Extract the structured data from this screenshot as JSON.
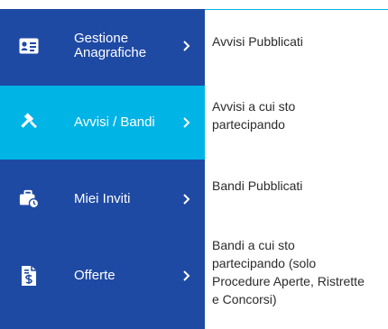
{
  "colors": {
    "sidebar": "#1f4aa4",
    "active": "#00b4e6",
    "text": "#2b2b2b"
  },
  "menu": [
    {
      "label": "Gestione\nAnagrafiche",
      "icon": "id-card-icon",
      "active": false
    },
    {
      "label": "Avvisi / Bandi",
      "icon": "gavel-icon",
      "active": true
    },
    {
      "label": "Miei Inviti",
      "icon": "briefcase-clock-icon",
      "active": false
    },
    {
      "label": "Offerte",
      "icon": "dollar-document-icon",
      "active": false
    }
  ],
  "descriptions": [
    "Avvisi Pubblicati",
    "Avvisi a cui sto\npartecipando",
    "Bandi Pubblicati",
    "Bandi a cui sto\npartecipando (solo\nProcedure Aperte, Ristrette\ne Concorsi)"
  ]
}
